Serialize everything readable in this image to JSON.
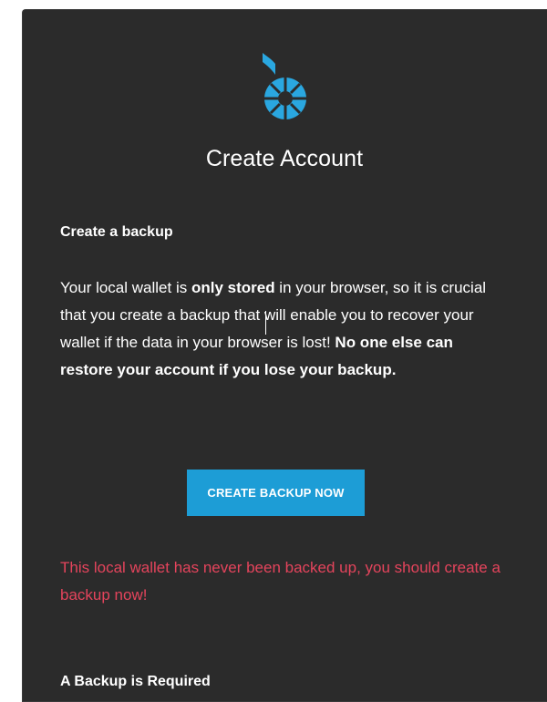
{
  "dialog": {
    "title": "Create Account",
    "logo_icon": "bitshares-logo-icon",
    "accent_color": "#1d9dd6",
    "panel_color": "#2b2b2b"
  },
  "backup_section": {
    "heading": "Create a backup",
    "paragraph": {
      "part1": "Your local wallet is ",
      "part2": "only stored",
      "part3": " in your browser, so it is crucial that you create a backup that will enable you to recover your wallet if the data in your browser is lost! ",
      "part4": "No one else can restore your account if you lose your backup."
    },
    "button_label": "CREATE BACKUP NOW",
    "warning": "This local wallet has never been backed up, you should create a backup now!",
    "warning_color": "#e4445c"
  },
  "required_section": {
    "heading": "A Backup is Required"
  }
}
